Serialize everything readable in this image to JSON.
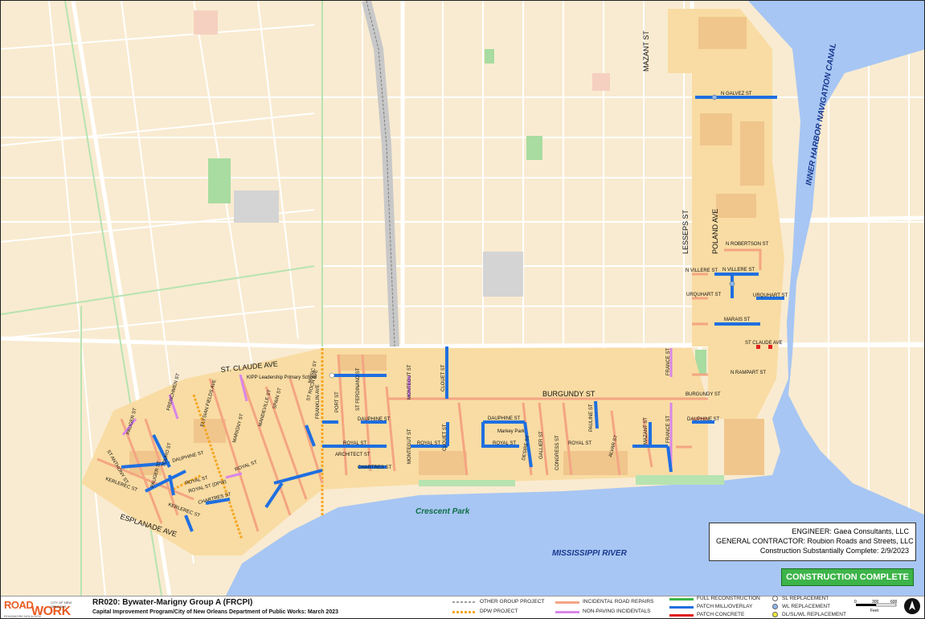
{
  "map": {
    "water_labels": {
      "canal": "INNER HARBOR NAVIGATION CANAL",
      "river": "MISSISSIPPI RIVER"
    },
    "park_label": "Crescent Park",
    "major_streets": {
      "st_claude": "ST. CLAUDE AVE",
      "esplanade": "ESPLANADE AVE",
      "burgundy": "BURGUNDY ST",
      "lesseps": "LESSEPS ST",
      "poland": "POLAND AVE",
      "mazant": "MAZANT ST"
    },
    "street_labels": {
      "n_galvez": "N GALVEZ ST",
      "n_robertson": "N ROBERTSON ST",
      "n_villere": "N VILLERE ST",
      "n_villere_2": "N VILLERE ST",
      "urquhart": "URQUHART ST",
      "urquhart_2": "URQUHART ST",
      "marais": "MARAIS ST",
      "st_claude_ave": "ST CLAUDE AVE",
      "n_rampart": "N RAMPART ST",
      "burgundy_small": "BURGUNDY ST",
      "dauphine_1": "DAUPHINE ST",
      "dauphine_2": "DAUPHINE ST",
      "dauphine_3": "DAUPHINE ST",
      "dauphine_4": "DAUPHINE ST",
      "royal_1": "ROYAL ST",
      "royal_2": "ROYAL ST",
      "royal_3": "ROYAL ST",
      "royal_4": "ROYAL ST",
      "royal_5": "ROYAL ST",
      "royal_6": "ROYAL ST",
      "royal_dpw": "ROYAL ST (DPW)",
      "chartres_1": "CHARTRES ST",
      "chartres_2": "CHARTRES ST",
      "architect": "ARCHITECT ST",
      "kerlerec_1": "KERLEREC ST",
      "kerlerec_2": "KERLEREC ST",
      "france_1": "FRANCE ST",
      "france_2": "FRANCE ST",
      "mazant_small": "MAZANT ST",
      "alvar": "ALVAR ST",
      "pauline": "PAULINE ST",
      "congress": "CONGRESS ST",
      "gallier": "GALLIER ST",
      "desire": "DESIRE ST",
      "clouet_1": "CLOUET ST",
      "clouet_2": "CLOUET ST",
      "montegut_1": "MONTEGUT ST",
      "montegut_2": "MONTEGUT ST",
      "st_ferdinand": "ST FERDINAND ST",
      "port": "PORT ST",
      "franklin": "FRANKLIN AVE",
      "mandeville": "MANDEVILLE ST",
      "spain": "SPAIN ST",
      "st_roch": "ST ROCH AVE",
      "marigny": "MARIGNY ST",
      "elysian": "ELYSIAN FIELDS AVE",
      "frenchmen": "FRENCHMEN ST",
      "touro": "TOURO ST",
      "pauger_1": "PAUGER ST",
      "pauger_2": "PAUGER ST",
      "st_anthony": "ST ANTHONY ST",
      "music": "MUSIC ST",
      "kipp": "KIPP Leadership Primary School",
      "markey": "Markey Park"
    }
  },
  "info_box": {
    "engineer": "ENGINEER:  Gaea Consultants, LLC",
    "contractor": "GENERAL CONTRACTOR:  Roubion Roads and Streets, LLC",
    "completion": "Construction Substantially Complete:  2/9/2023"
  },
  "status": "CONSTRUCTION COMPLETE",
  "footer": {
    "logo_road": "ROAD",
    "logo_work": "WORK",
    "logo_city": "CITY OF NEW ORLEANS",
    "logo_url": "ROADWORK.NOLA.GOV",
    "title": "RR020:  Bywater-Marigny Group A (FRCPI)",
    "subtitle": "Capital Improvement Program/City of New Orleans Department of Public Works:  March 2023"
  },
  "legend": [
    {
      "label": "OTHER GROUP PROJECT",
      "color": "#9e9e9e",
      "style": "dashed-line"
    },
    {
      "label": "DPW PROJECT",
      "color": "#f5a623",
      "style": "dashed-line"
    },
    {
      "label": "INCIDENTAL ROAD REPAIRS",
      "color": "#f4a582",
      "style": "line"
    },
    {
      "label": "NON-PAVING INCIDENTALS",
      "color": "#d986e8",
      "style": "line"
    },
    {
      "label": "FULL RECONSTRUCTION",
      "color": "#3cb449",
      "style": "line"
    },
    {
      "label": "PATCH MILL/OVERLAY",
      "color": "#1f6fe0",
      "style": "line"
    },
    {
      "label": "PATCH CONCRETE",
      "color": "#e22020",
      "style": "line"
    },
    {
      "label": "SL REPLACEMENT",
      "color": "#ffffff",
      "style": "dot"
    },
    {
      "label": "WL REPLACEMENT",
      "color": "#8fb8f0",
      "style": "dot"
    },
    {
      "label": "DL/SL/WL REPLACEMENT",
      "color": "#f2e93a",
      "style": "dot"
    }
  ],
  "scale": {
    "ticks": [
      "0",
      "300",
      "600"
    ],
    "unit": "Feet"
  },
  "colors": {
    "land": "#f9ebd1",
    "project_area": "#f9dca3",
    "water": "#a7c6f3",
    "road": "#ffffff",
    "highway_green": "#b7e3b0",
    "park": "#a8dca0",
    "building": "#f0c68c"
  }
}
